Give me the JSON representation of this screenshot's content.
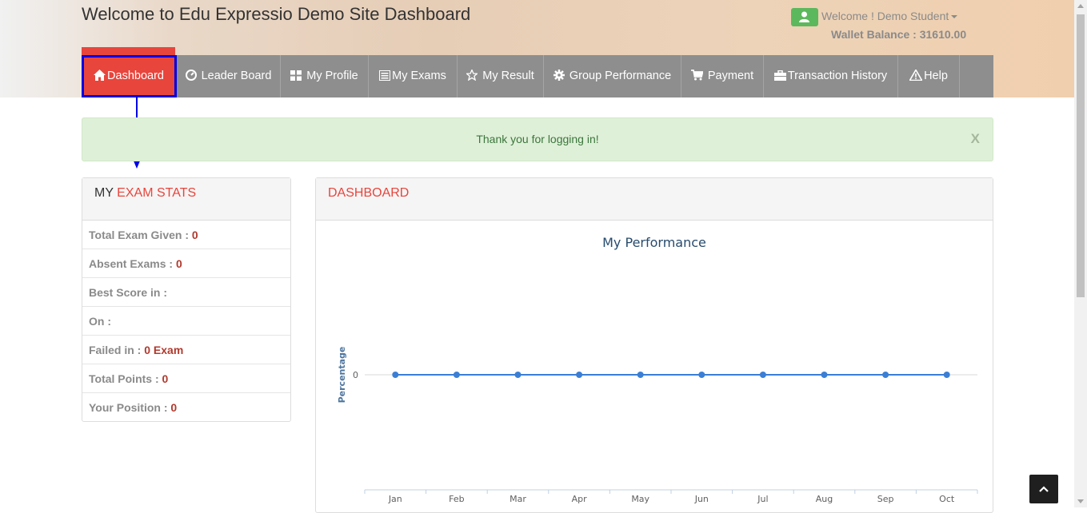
{
  "header": {
    "title": "Welcome to Edu Expressio Demo Site Dashboard",
    "welcome_text": "Welcome ! Demo Student",
    "wallet_text": "Wallet Balance : 31610.00",
    "user_icon": "user-icon"
  },
  "nav": {
    "items": [
      {
        "label": "Dashboard",
        "icon": "home-icon",
        "active": true
      },
      {
        "label": "Leader Board",
        "icon": "dashboard-gauge-icon"
      },
      {
        "label": "My Profile",
        "icon": "grid-icon"
      },
      {
        "label": "My Exams",
        "icon": "list-icon"
      },
      {
        "label": "My Result",
        "icon": "star-icon"
      },
      {
        "label": "Group Performance",
        "icon": "gear-icon"
      },
      {
        "label": "Payment",
        "icon": "cart-icon"
      },
      {
        "label": "Transaction History",
        "icon": "briefcase-icon"
      },
      {
        "label": "Help",
        "icon": "warning-icon"
      }
    ]
  },
  "alert": {
    "message": "Thank you for logging in!",
    "close_label": "X"
  },
  "stats": {
    "title_prefix": "MY",
    "title_highlight": "EXAM STATS",
    "rows": [
      {
        "label": "Total Exam Given :",
        "value": "0"
      },
      {
        "label": "Absent Exams :",
        "value": "0"
      },
      {
        "label": "Best Score in :",
        "value": ""
      },
      {
        "label": "On :",
        "value": ""
      },
      {
        "label": "Failed in :",
        "value": "0 Exam"
      },
      {
        "label": "Total Points :",
        "value": "0"
      },
      {
        "label": "Your Position :",
        "value": "0"
      }
    ]
  },
  "dashboard": {
    "title": "DASHBOARD"
  },
  "chart_data": {
    "type": "line",
    "title": "My Performance",
    "ylabel": "Percentage",
    "xlabel": "",
    "categories": [
      "Jan",
      "Feb",
      "Mar",
      "Apr",
      "May",
      "Jun",
      "Jul",
      "Aug",
      "Sep",
      "Oct"
    ],
    "series": [
      {
        "values": [
          0,
          0,
          0,
          0,
          0,
          0,
          0,
          0,
          0,
          0
        ],
        "color": "#3a7fd5"
      }
    ],
    "yticks": [
      "0"
    ],
    "grid": true
  },
  "colors": {
    "accent": "#e8453c",
    "nav_bg": "#8e8e8e",
    "annotation": "#0000e6",
    "success_bg": "#dff0d8",
    "series": "#3a7fd5"
  }
}
